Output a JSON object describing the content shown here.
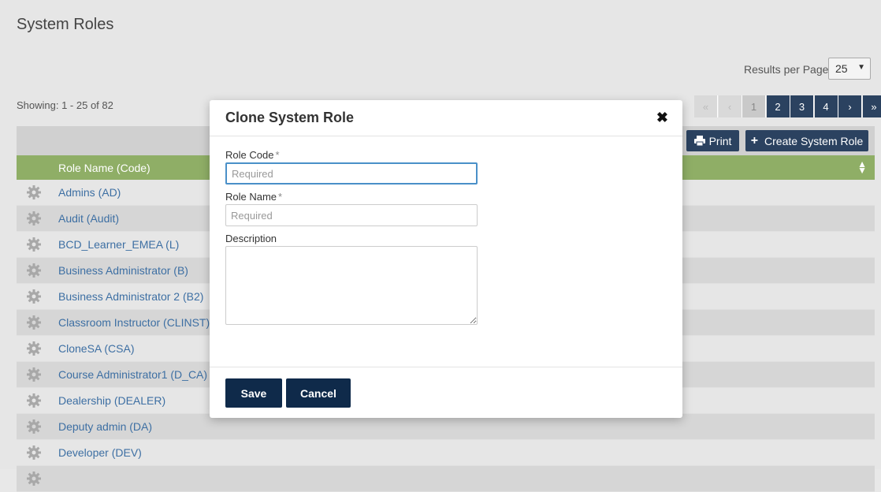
{
  "page": {
    "title": "System Roles",
    "results_per_page_label": "Results per Page:",
    "results_per_page_value": "25",
    "showing": "Showing: 1 - 25 of 82"
  },
  "pagination": {
    "first": "«",
    "prev": "‹",
    "pages": [
      "1",
      "2",
      "3",
      "4"
    ],
    "next": "›",
    "last": "»"
  },
  "toolbar": {
    "print_label": "Print",
    "create_label": "Create System Role"
  },
  "table": {
    "header": "Role Name (Code)",
    "rows": [
      "Admins (AD)",
      "Audit (Audit)",
      "BCD_Learner_EMEA (L)",
      "Business Administrator (B)",
      "Business Administrator 2 (B2)",
      "Classroom Instructor (CLINST)",
      "CloneSA (CSA)",
      "Course Administrator1 (D_CA)",
      "Dealership (DEALER)",
      "Deputy admin (DA)",
      "Developer (DEV)"
    ]
  },
  "modal": {
    "title": "Clone System Role",
    "role_code_label": "Role Code",
    "role_code_placeholder": "Required",
    "role_code_value": "",
    "role_name_label": "Role Name",
    "role_name_placeholder": "Required",
    "role_name_value": "",
    "description_label": "Description",
    "description_value": "",
    "required_marker": "*",
    "save_label": "Save",
    "cancel_label": "Cancel"
  },
  "colors": {
    "primary": "#2b4260",
    "modal_button": "#0f2a4a",
    "table_header": "#8fae66",
    "link": "#3d6fa3"
  }
}
